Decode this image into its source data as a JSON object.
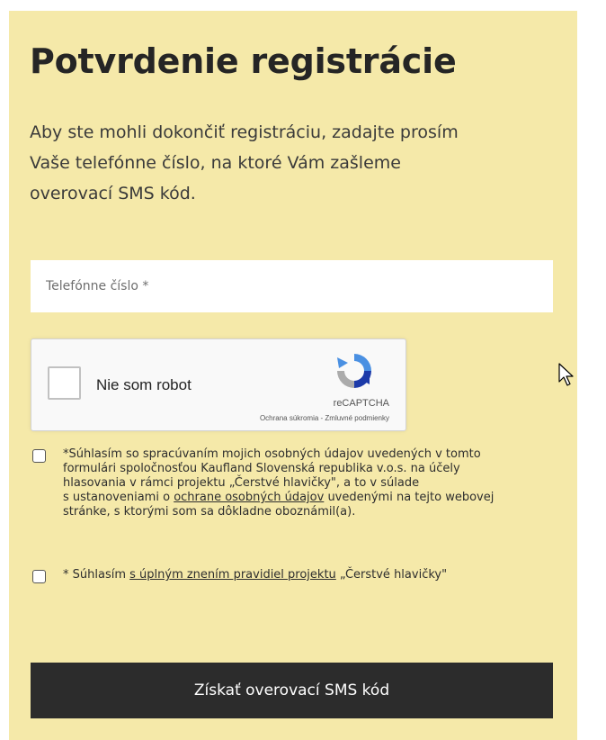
{
  "colors": {
    "panel_bg": "#f5e9a9",
    "button_bg": "#2c2c2c",
    "text_dark": "#252525"
  },
  "page": {
    "title": "Potvrdenie registrácie",
    "intro_line1": "Aby ste mohli dokončiť registráciu, zadajte prosím",
    "intro_line2": "Vaše telefónne číslo, na ktoré Vám zašleme",
    "intro_line3": "overovací SMS kód."
  },
  "phone": {
    "placeholder": "Telefónne číslo *",
    "value": ""
  },
  "recaptcha": {
    "label": "Nie som robot",
    "brand": "reCAPTCHA",
    "privacy": "Ochrana súkromia",
    "separator": " - ",
    "terms": "Zmluvné podmienky",
    "logo_icon": "recaptcha-logo-icon"
  },
  "consent1": {
    "line1": "*Súhlasím so spracúvaním mojich osobných údajov uvedených v tomto",
    "line2": "formulári spoločnosťou Kaufland Slovenská republika v.o.s. na účely",
    "line3": "hlasovania v rámci projektu „Čerstvé hlavičky\", a to v súlade",
    "line4_pre": "s ustanoveniami o ",
    "line4_link": "ochrane osobných údajov",
    "line4_post": " uvedenými na tejto webovej",
    "line5": "stránke, s ktorými som sa dôkladne oboznámil(a)."
  },
  "consent2": {
    "pre": "* Súhlasím ",
    "link": "s úplným znením pravidiel projektu",
    "post": " „Čerstvé hlavičky\""
  },
  "submit": {
    "label": "Získať overovací SMS kód"
  }
}
